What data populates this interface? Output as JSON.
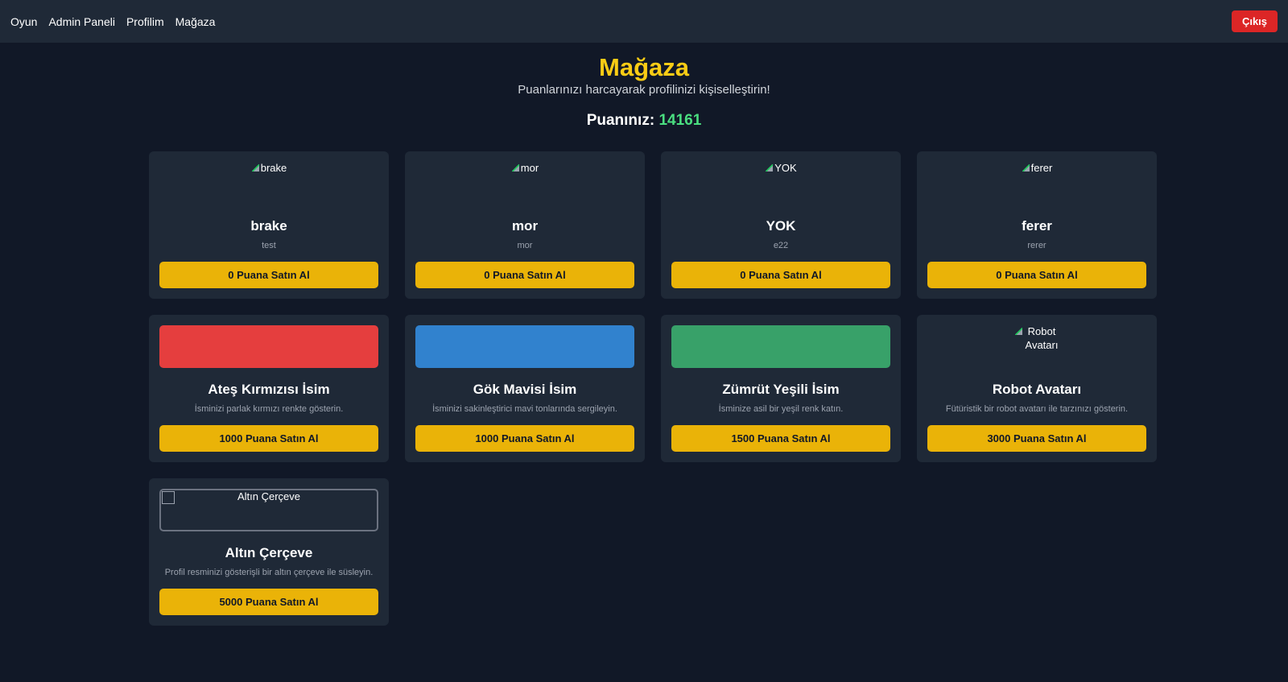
{
  "nav": {
    "links": [
      "Oyun",
      "Admin Paneli",
      "Profilim",
      "Mağaza"
    ],
    "logout_label": "Çıkış"
  },
  "header": {
    "title": "Mağaza",
    "subtitle": "Puanlarınızı harcayarak profilinizi kişiselleştirin!",
    "points_label": "Puanınız:",
    "points_value": "14161"
  },
  "colors": {
    "accent": "#facc15",
    "points": "#4ade80",
    "logout": "#dc2626",
    "red_swatch": "#e53e3e",
    "blue_swatch": "#3182ce",
    "green_swatch": "#38a169"
  },
  "items": [
    {
      "name": "brake",
      "desc": "test",
      "alt": "brake",
      "button": "0 Puana Satın Al"
    },
    {
      "name": "mor",
      "desc": "mor",
      "alt": "mor",
      "button": "0 Puana Satın Al"
    },
    {
      "name": "YOK",
      "desc": "e22",
      "alt": "YOK",
      "button": "0 Puana Satın Al"
    },
    {
      "name": "ferer",
      "desc": "rerer",
      "alt": "ferer",
      "button": "0 Puana Satın Al"
    },
    {
      "name": "Ateş Kırmızısı İsim",
      "desc": "İsminizi parlak kırmızı renkte gösterin.",
      "button": "1000 Puana Satın Al"
    },
    {
      "name": "Gök Mavisi İsim",
      "desc": "İsminizi sakinleştirici mavi tonlarında sergileyin.",
      "button": "1000 Puana Satın Al"
    },
    {
      "name": "Zümrüt Yeşili İsim",
      "desc": "İsminize asil bir yeşil renk katın.",
      "button": "1500 Puana Satın Al"
    },
    {
      "name": "Robot Avatarı",
      "desc": "Fütüristik bir robot avatarı ile tarzınızı gösterin.",
      "alt": "Robot Avatarı",
      "button": "3000 Puana Satın Al"
    },
    {
      "name": "Altın Çerçeve",
      "desc": "Profil resminizi gösterişli bir altın çerçeve ile süsleyin.",
      "alt": "Altın Çerçeve",
      "button": "5000 Puana Satın Al"
    }
  ]
}
